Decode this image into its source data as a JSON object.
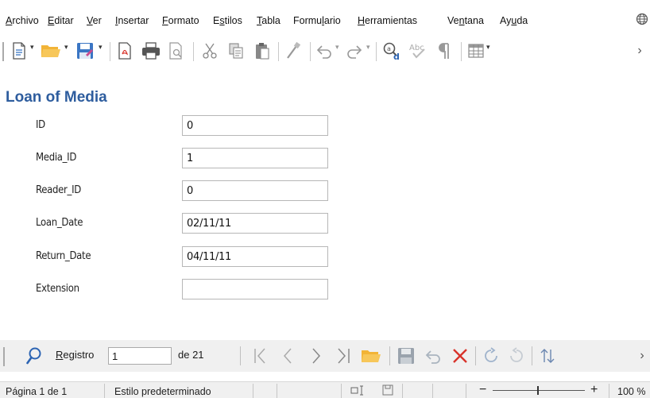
{
  "menu": {
    "items": [
      {
        "pre": "",
        "u": "A",
        "post": "rchivo"
      },
      {
        "pre": "",
        "u": "E",
        "post": "ditar"
      },
      {
        "pre": "",
        "u": "V",
        "post": "er"
      },
      {
        "pre": "",
        "u": "I",
        "post": "nsertar"
      },
      {
        "pre": "",
        "u": "F",
        "post": "ormato"
      },
      {
        "pre": "E",
        "u": "s",
        "post": "tilos"
      },
      {
        "pre": "",
        "u": "T",
        "post": "abla"
      },
      {
        "pre": "Formu",
        "u": "l",
        "post": "ario"
      },
      {
        "pre": "",
        "u": "H",
        "post": "erramientas"
      },
      {
        "pre": "Ve",
        "u": "n",
        "post": "tana"
      },
      {
        "pre": "Ay",
        "u": "u",
        "post": "da"
      }
    ],
    "globe_icon": "globe-icon"
  },
  "toolbar": {
    "icons": [
      "new-document-icon",
      "open-folder-icon",
      "save-icon",
      "export-pdf-icon",
      "print-icon",
      "print-preview-icon",
      "cut-icon",
      "copy-icon",
      "paste-icon",
      "clone-formatting-icon",
      "undo-icon",
      "redo-icon",
      "find-replace-icon",
      "spellcheck-icon",
      "formatting-marks-icon",
      "table-icon"
    ],
    "more": "›"
  },
  "form": {
    "title": "Loan of Media",
    "fields": [
      {
        "label": "ID",
        "value": "0"
      },
      {
        "label": "Media_ID",
        "value": "1"
      },
      {
        "label": "Reader_ID",
        "value": "0"
      },
      {
        "label": "Loan_Date",
        "value": "02/11/11"
      },
      {
        "label": "Return_Date",
        "value": "04/11/11"
      },
      {
        "label": "Extension",
        "value": ""
      }
    ]
  },
  "navigation": {
    "record_label_u": "R",
    "record_label_rest": "egistro",
    "record_value": "1",
    "record_of": "de 21",
    "more": "›"
  },
  "status": {
    "page": "Página 1 de 1",
    "style": "Estilo predeterminado",
    "zoom": "100 %",
    "minus": "−",
    "plus": "+"
  },
  "colors": {
    "title": "#2e5d9e",
    "folder": "#f2b437",
    "save": "#3a76c4",
    "delete": "#d8332b",
    "search": "#2c64b3"
  }
}
